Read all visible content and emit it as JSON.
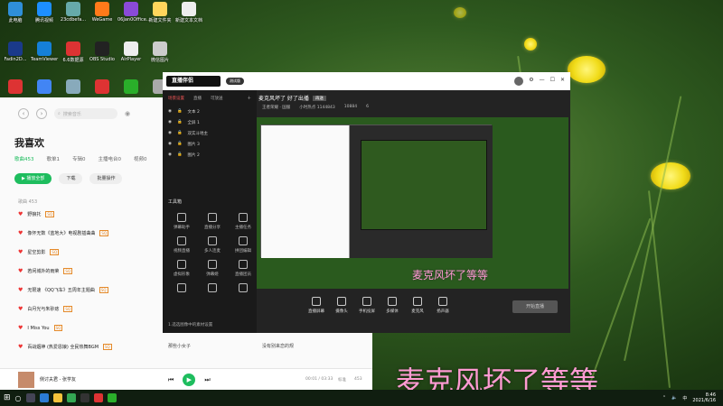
{
  "desktop": {
    "icons": [
      {
        "label": "此电脑",
        "color": "#2f8fd8"
      },
      {
        "label": "腾讯视频",
        "color": "#1d8fff"
      },
      {
        "label": "23cdbefa...",
        "color": "#6aa"
      },
      {
        "label": "WeGame",
        "color": "#ff7a1a"
      },
      {
        "label": "06Jan0Office...",
        "color": "#8a4ad8"
      },
      {
        "label": "新建文件夹",
        "color": "#ffd65c"
      },
      {
        "label": "新建文本文档",
        "color": "#eee"
      },
      {
        "label": "Fadin2D...",
        "color": "#1a3a8a"
      },
      {
        "label": "TeamViewer",
        "color": "#1580d8"
      },
      {
        "label": "6.6数据源",
        "color": "#d33"
      },
      {
        "label": "OBS Studio",
        "color": "#222"
      },
      {
        "label": "AirPlayer",
        "color": "#eee"
      },
      {
        "label": "微信图片",
        "color": "#ccc"
      },
      {
        "label": "",
        "color": "#d33"
      },
      {
        "label": "",
        "color": "#4285f4"
      },
      {
        "label": "",
        "color": "#8ab"
      },
      {
        "label": "",
        "color": "#d33"
      },
      {
        "label": "",
        "color": "#2aae2a"
      },
      {
        "label": "",
        "color": "#aaa"
      }
    ]
  },
  "music": {
    "search_placeholder": "搜索音乐",
    "title": "我喜欢",
    "tabs": [
      "歌曲453",
      "歌单1",
      "专辑0",
      "主播电台0",
      "视频0"
    ],
    "buttons": {
      "play_all": "▶ 播放全部",
      "download": "下载",
      "batch": "批量操作"
    },
    "list_header": "歌曲 453",
    "songs": [
      {
        "title": "野狼托",
        "tag": "SQ"
      },
      {
        "title": "像怀无数《蓝地大》电视剧插曲曲",
        "tag": "SQ"
      },
      {
        "title": "星空剪影",
        "tag": "SQ"
      },
      {
        "title": "若闲城外的雨荣",
        "tag": "SQ"
      },
      {
        "title": "无限速 《QQ飞车》五周年主题曲",
        "tag": "SQ"
      },
      {
        "title": "白月光与朱砂痣",
        "tag": "SQ"
      },
      {
        "title": "I Miss You",
        "tag": "SQ"
      },
      {
        "title": "百战烟神 (热爱恩娘) 全民热舞BGM",
        "tag": "SQ"
      }
    ],
    "extra_left": "那些小女子",
    "extra_right": "没有别来恋的规",
    "player": {
      "now_playing": "侧讨夫君  - 张学友",
      "time": "00:01 / 03:33",
      "quality": "标准",
      "count": "453"
    }
  },
  "obs": {
    "logo": "直播伴侣",
    "version": "测试版",
    "left_tabs": [
      "场景设置",
      "直播",
      "可放送"
    ],
    "scenes": [
      "文本 2",
      "全屏 1",
      "双实斗地主",
      "图片 3",
      "图片 2"
    ],
    "tools_title": "工具箱",
    "tools": [
      "弹幕助手",
      "直播分享",
      "主播任务",
      "视频直播",
      "多人连麦",
      "拼团编辑",
      "虚拟形象",
      "弹幕姬",
      "直播团员",
      "",
      "",
      ""
    ],
    "status": "1.选选图像中的素材设置",
    "room_title": "麦克风坏了 好了出播",
    "room_tag": "再送",
    "meta": [
      "王者荣耀 · 国服",
      "小时热点 1144843",
      "10884",
      "6"
    ],
    "overlay_text": "麦克风坏了等等",
    "bottom_icons": [
      "直播屏幕",
      "摄像头",
      "手机投屏",
      "多媒体",
      "麦克风",
      "扬声器"
    ],
    "live_btn": "开始直播"
  },
  "big_overlay": "麦克风坏了等等",
  "taskbar": {
    "time": "8:46",
    "date": "2021/6/16"
  }
}
